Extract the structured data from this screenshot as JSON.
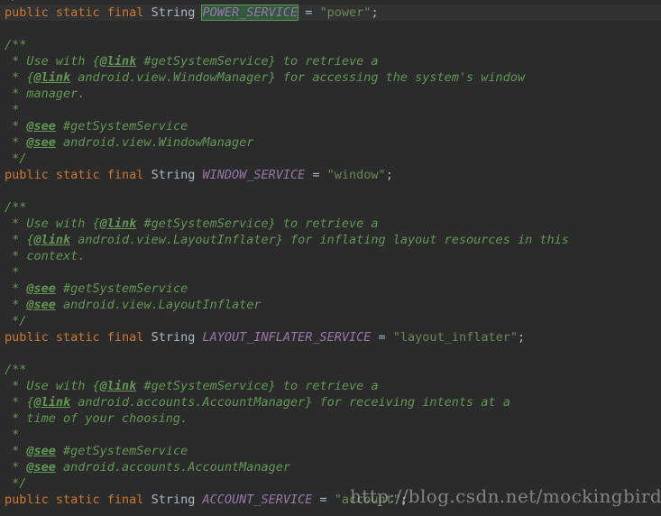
{
  "editor": {
    "background": "#2b2b2b",
    "current_line_background": "#323232",
    "default_text_color": "#a9b7c6",
    "keyword_color": "#cc7832",
    "constant_color": "#9876aa",
    "string_color": "#6a8759",
    "comment_color": "#629755",
    "highlight_background": "#32593d",
    "highlight_border": "#629755"
  },
  "watermark": {
    "text": "http://blog.csdn.net/mockingbirds"
  },
  "lines": [
    {
      "id": "line-partial-top",
      "current": false,
      "tokens": [
        {
          "cls": "cm",
          "text": " /"
        }
      ]
    },
    {
      "id": "line-power-service-decl",
      "current": true,
      "tokens": [
        {
          "cls": "kw",
          "text": "public static final "
        },
        {
          "cls": "type",
          "text": "String "
        },
        {
          "cls": "hl",
          "text": "POWER_SERVICE"
        },
        {
          "cls": "punc",
          "text": " = "
        },
        {
          "cls": "str",
          "text": "\"power\""
        },
        {
          "cls": "punc",
          "text": ";"
        }
      ]
    },
    {
      "id": "line-blank-1",
      "current": false,
      "tokens": []
    },
    {
      "id": "line-window-doc-open",
      "current": false,
      "tokens": [
        {
          "cls": "cm",
          "text": "/**"
        }
      ]
    },
    {
      "id": "line-window-doc-1",
      "current": false,
      "tokens": [
        {
          "cls": "cm",
          "text": " * Use with {"
        },
        {
          "cls": "cmtag",
          "text": "@link"
        },
        {
          "cls": "cm",
          "text": " #getSystemService} to retrieve a"
        }
      ]
    },
    {
      "id": "line-window-doc-2",
      "current": false,
      "tokens": [
        {
          "cls": "cm",
          "text": " * {"
        },
        {
          "cls": "cmtag",
          "text": "@link"
        },
        {
          "cls": "cm",
          "text": " android.view.WindowManager} for accessing the system's window"
        }
      ]
    },
    {
      "id": "line-window-doc-3",
      "current": false,
      "tokens": [
        {
          "cls": "cm",
          "text": " * manager."
        }
      ]
    },
    {
      "id": "line-window-doc-4",
      "current": false,
      "tokens": [
        {
          "cls": "cm",
          "text": " *"
        }
      ]
    },
    {
      "id": "line-window-doc-see-1",
      "current": false,
      "tokens": [
        {
          "cls": "cm",
          "text": " * "
        },
        {
          "cls": "cmtag",
          "text": "@see"
        },
        {
          "cls": "cm",
          "text": " #getSystemService"
        }
      ]
    },
    {
      "id": "line-window-doc-see-2",
      "current": false,
      "tokens": [
        {
          "cls": "cm",
          "text": " * "
        },
        {
          "cls": "cmtag",
          "text": "@see"
        },
        {
          "cls": "cm",
          "text": " android.view.WindowManager"
        }
      ]
    },
    {
      "id": "line-window-doc-close",
      "current": false,
      "tokens": [
        {
          "cls": "cm",
          "text": " */"
        }
      ]
    },
    {
      "id": "line-window-service-decl",
      "current": false,
      "tokens": [
        {
          "cls": "kw",
          "text": "public static final "
        },
        {
          "cls": "type",
          "text": "String "
        },
        {
          "cls": "const",
          "text": "WINDOW_SERVICE"
        },
        {
          "cls": "punc",
          "text": " = "
        },
        {
          "cls": "str",
          "text": "\"window\""
        },
        {
          "cls": "punc",
          "text": ";"
        }
      ]
    },
    {
      "id": "line-blank-2",
      "current": false,
      "tokens": []
    },
    {
      "id": "line-inflater-doc-open",
      "current": false,
      "tokens": [
        {
          "cls": "cm",
          "text": "/**"
        }
      ]
    },
    {
      "id": "line-inflater-doc-1",
      "current": false,
      "tokens": [
        {
          "cls": "cm",
          "text": " * Use with {"
        },
        {
          "cls": "cmtag",
          "text": "@link"
        },
        {
          "cls": "cm",
          "text": " #getSystemService} to retrieve a"
        }
      ]
    },
    {
      "id": "line-inflater-doc-2",
      "current": false,
      "tokens": [
        {
          "cls": "cm",
          "text": " * {"
        },
        {
          "cls": "cmtag",
          "text": "@link"
        },
        {
          "cls": "cm",
          "text": " android.view.LayoutInflater} for inflating layout resources in this"
        }
      ]
    },
    {
      "id": "line-inflater-doc-3",
      "current": false,
      "tokens": [
        {
          "cls": "cm",
          "text": " * context."
        }
      ]
    },
    {
      "id": "line-inflater-doc-4",
      "current": false,
      "tokens": [
        {
          "cls": "cm",
          "text": " *"
        }
      ]
    },
    {
      "id": "line-inflater-doc-see-1",
      "current": false,
      "tokens": [
        {
          "cls": "cm",
          "text": " * "
        },
        {
          "cls": "cmtag",
          "text": "@see"
        },
        {
          "cls": "cm",
          "text": " #getSystemService"
        }
      ]
    },
    {
      "id": "line-inflater-doc-see-2",
      "current": false,
      "tokens": [
        {
          "cls": "cm",
          "text": " * "
        },
        {
          "cls": "cmtag",
          "text": "@see"
        },
        {
          "cls": "cm",
          "text": " android.view.LayoutInflater"
        }
      ]
    },
    {
      "id": "line-inflater-doc-close",
      "current": false,
      "tokens": [
        {
          "cls": "cm",
          "text": " */"
        }
      ]
    },
    {
      "id": "line-layout-inflater-service-decl",
      "current": false,
      "tokens": [
        {
          "cls": "kw",
          "text": "public static final "
        },
        {
          "cls": "type",
          "text": "String "
        },
        {
          "cls": "const",
          "text": "LAYOUT_INFLATER_SERVICE"
        },
        {
          "cls": "punc",
          "text": " = "
        },
        {
          "cls": "str",
          "text": "\"layout_inflater\""
        },
        {
          "cls": "punc",
          "text": ";"
        }
      ]
    },
    {
      "id": "line-blank-3",
      "current": false,
      "tokens": []
    },
    {
      "id": "line-account-doc-open",
      "current": false,
      "tokens": [
        {
          "cls": "cm",
          "text": "/**"
        }
      ]
    },
    {
      "id": "line-account-doc-1",
      "current": false,
      "tokens": [
        {
          "cls": "cm",
          "text": " * Use with {"
        },
        {
          "cls": "cmtag",
          "text": "@link"
        },
        {
          "cls": "cm",
          "text": " #getSystemService} to retrieve a"
        }
      ]
    },
    {
      "id": "line-account-doc-2",
      "current": false,
      "tokens": [
        {
          "cls": "cm",
          "text": " * {"
        },
        {
          "cls": "cmtag",
          "text": "@link"
        },
        {
          "cls": "cm",
          "text": " android.accounts.AccountManager} for receiving intents at a"
        }
      ]
    },
    {
      "id": "line-account-doc-3",
      "current": false,
      "tokens": [
        {
          "cls": "cm",
          "text": " * time of your choosing."
        }
      ]
    },
    {
      "id": "line-account-doc-4",
      "current": false,
      "tokens": [
        {
          "cls": "cm",
          "text": " *"
        }
      ]
    },
    {
      "id": "line-account-doc-see-1",
      "current": false,
      "tokens": [
        {
          "cls": "cm",
          "text": " * "
        },
        {
          "cls": "cmtag",
          "text": "@see"
        },
        {
          "cls": "cm",
          "text": " #getSystemService"
        }
      ]
    },
    {
      "id": "line-account-doc-see-2",
      "current": false,
      "tokens": [
        {
          "cls": "cm",
          "text": " * "
        },
        {
          "cls": "cmtag",
          "text": "@see"
        },
        {
          "cls": "cm",
          "text": " android.accounts.AccountManager"
        }
      ]
    },
    {
      "id": "line-account-doc-close",
      "current": false,
      "tokens": [
        {
          "cls": "cm",
          "text": " */"
        }
      ]
    },
    {
      "id": "line-account-service-decl",
      "current": false,
      "tokens": [
        {
          "cls": "kw",
          "text": "public static final "
        },
        {
          "cls": "type",
          "text": "String "
        },
        {
          "cls": "const",
          "text": "ACCOUNT_SERVICE"
        },
        {
          "cls": "punc",
          "text": " = "
        },
        {
          "cls": "str",
          "text": "\"account\""
        },
        {
          "cls": "punc",
          "text": ";"
        }
      ]
    }
  ]
}
